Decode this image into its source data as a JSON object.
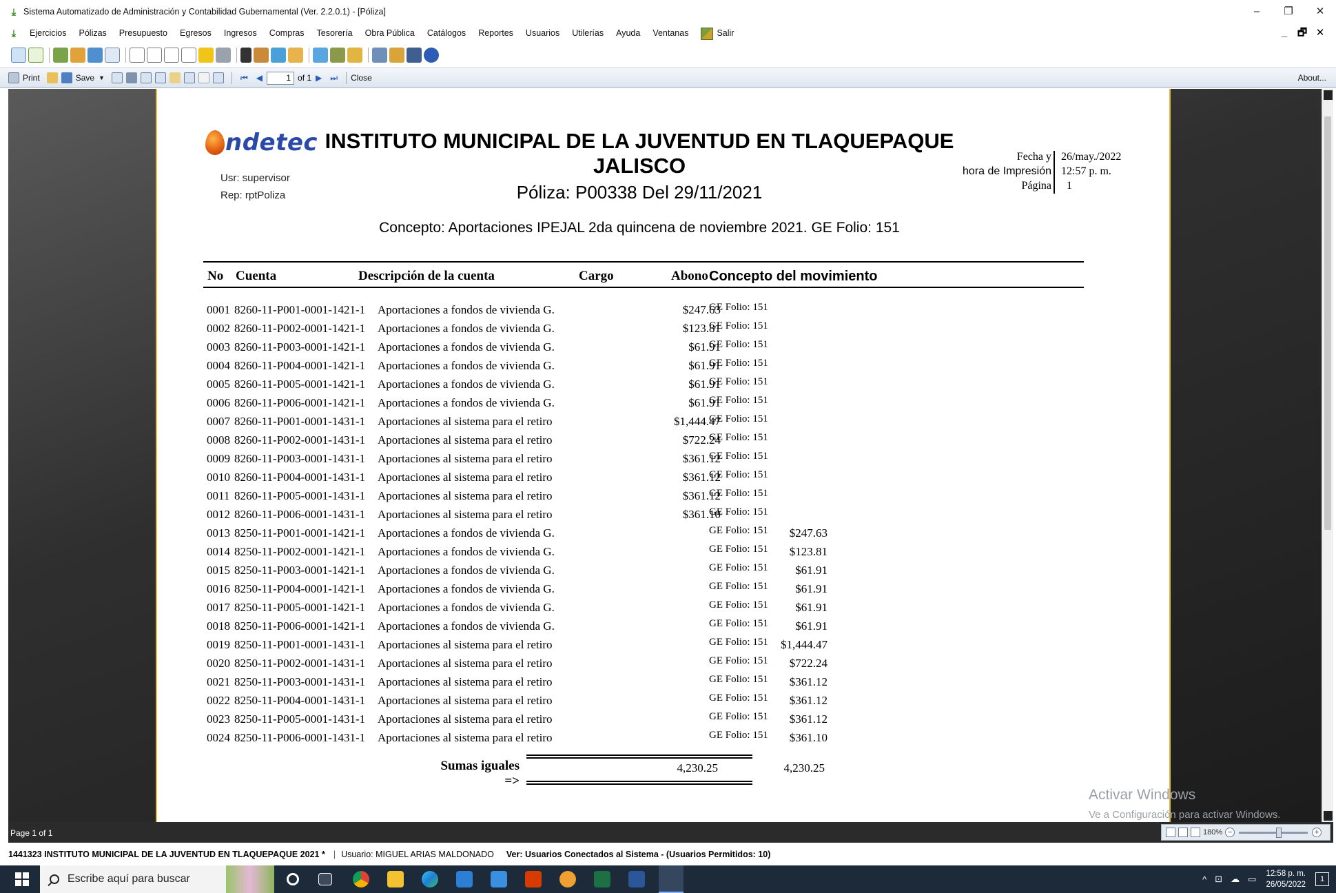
{
  "window": {
    "title": "Sistema Automatizado de Administración y Contabilidad Gubernamental  (Ver. 2.2.0.1) - [Póliza]",
    "controls": [
      "–",
      "❐",
      "✕"
    ]
  },
  "menubar": {
    "items": [
      "Ejercicios",
      "Pólizas",
      "Presupuesto",
      "Egresos",
      "Ingresos",
      "Compras",
      "Tesorería",
      "Obra Pública",
      "Catálogos",
      "Reportes",
      "Usuarios",
      "Utilerías",
      "Ayuda",
      "Ventanas"
    ],
    "salir_label": "Salir",
    "mdi_controls": [
      "_",
      "🗗",
      "✕"
    ]
  },
  "viewer_toolbar": {
    "print_label": "Print",
    "save_label": "Save",
    "page_value": "1",
    "page_of": "of 1",
    "close_label": "Close",
    "about_label": "About..."
  },
  "report": {
    "logo_text": "ndetec",
    "user_line": "Usr: supervisor",
    "rep_line": "Rep: rptPoliza",
    "org_line1": "INSTITUTO MUNICIPAL DE LA JUVENTUD EN TLAQUEPAQUE",
    "org_line2": "JALISCO",
    "poliza_line": "Póliza:  P00338  Del 29/11/2021",
    "concepto_line": "Concepto: Aportaciones IPEJAL 2da quincena de noviembre 2021. GE Folio: 151",
    "fecha_label": "Fecha y",
    "hora_label": "hora de Impresión",
    "pagina_label": "Página",
    "fecha_value": "26/may./2022",
    "hora_value": "12:57 p. m.",
    "pagina_value": "1",
    "headers": {
      "no": "No",
      "cuenta": "Cuenta",
      "descripcion": "Descripción de la cuenta",
      "cargo": "Cargo",
      "abono": "Abono",
      "concepto": "Concepto del movimiento"
    },
    "rows": [
      {
        "no": "0001",
        "cuenta": "8260-11-P001-0001-1421-1",
        "desc": "Aportaciones a fondos de vivienda G.",
        "cargo": "$247.63",
        "abono": "",
        "conc": "GE Folio: 151"
      },
      {
        "no": "0002",
        "cuenta": "8260-11-P002-0001-1421-1",
        "desc": "Aportaciones a fondos de vivienda G.",
        "cargo": "$123.81",
        "abono": "",
        "conc": "GE Folio: 151"
      },
      {
        "no": "0003",
        "cuenta": "8260-11-P003-0001-1421-1",
        "desc": "Aportaciones a fondos de vivienda G.",
        "cargo": "$61.91",
        "abono": "",
        "conc": "GE Folio: 151"
      },
      {
        "no": "0004",
        "cuenta": "8260-11-P004-0001-1421-1",
        "desc": "Aportaciones a fondos de vivienda G.",
        "cargo": "$61.91",
        "abono": "",
        "conc": "GE Folio: 151"
      },
      {
        "no": "0005",
        "cuenta": "8260-11-P005-0001-1421-1",
        "desc": "Aportaciones a fondos de vivienda G.",
        "cargo": "$61.91",
        "abono": "",
        "conc": "GE Folio: 151"
      },
      {
        "no": "0006",
        "cuenta": "8260-11-P006-0001-1421-1",
        "desc": "Aportaciones a fondos de vivienda G.",
        "cargo": "$61.91",
        "abono": "",
        "conc": "GE Folio: 151"
      },
      {
        "no": "0007",
        "cuenta": "8260-11-P001-0001-1431-1",
        "desc": "Aportaciones al sistema para el retiro",
        "cargo": "$1,444.47",
        "abono": "",
        "conc": "GE Folio: 151"
      },
      {
        "no": "0008",
        "cuenta": "8260-11-P002-0001-1431-1",
        "desc": "Aportaciones al sistema para el retiro",
        "cargo": "$722.24",
        "abono": "",
        "conc": "GE Folio: 151"
      },
      {
        "no": "0009",
        "cuenta": "8260-11-P003-0001-1431-1",
        "desc": "Aportaciones al sistema para el retiro",
        "cargo": "$361.12",
        "abono": "",
        "conc": "GE Folio: 151"
      },
      {
        "no": "0010",
        "cuenta": "8260-11-P004-0001-1431-1",
        "desc": "Aportaciones al sistema para el retiro",
        "cargo": "$361.12",
        "abono": "",
        "conc": "GE Folio: 151"
      },
      {
        "no": "0011",
        "cuenta": "8260-11-P005-0001-1431-1",
        "desc": "Aportaciones al sistema para el retiro",
        "cargo": "$361.12",
        "abono": "",
        "conc": "GE Folio: 151"
      },
      {
        "no": "0012",
        "cuenta": "8260-11-P006-0001-1431-1",
        "desc": "Aportaciones al sistema para el retiro",
        "cargo": "$361.10",
        "abono": "",
        "conc": "GE Folio: 151"
      },
      {
        "no": "0013",
        "cuenta": "8250-11-P001-0001-1421-1",
        "desc": "Aportaciones a fondos de vivienda G.",
        "cargo": "",
        "abono": "$247.63",
        "conc": "GE Folio: 151"
      },
      {
        "no": "0014",
        "cuenta": "8250-11-P002-0001-1421-1",
        "desc": "Aportaciones a fondos de vivienda G.",
        "cargo": "",
        "abono": "$123.81",
        "conc": "GE Folio: 151"
      },
      {
        "no": "0015",
        "cuenta": "8250-11-P003-0001-1421-1",
        "desc": "Aportaciones a fondos de vivienda G.",
        "cargo": "",
        "abono": "$61.91",
        "conc": "GE Folio: 151"
      },
      {
        "no": "0016",
        "cuenta": "8250-11-P004-0001-1421-1",
        "desc": "Aportaciones a fondos de vivienda G.",
        "cargo": "",
        "abono": "$61.91",
        "conc": "GE Folio: 151"
      },
      {
        "no": "0017",
        "cuenta": "8250-11-P005-0001-1421-1",
        "desc": "Aportaciones a fondos de vivienda G.",
        "cargo": "",
        "abono": "$61.91",
        "conc": "GE Folio: 151"
      },
      {
        "no": "0018",
        "cuenta": "8250-11-P006-0001-1421-1",
        "desc": "Aportaciones a fondos de vivienda G.",
        "cargo": "",
        "abono": "$61.91",
        "conc": "GE Folio: 151"
      },
      {
        "no": "0019",
        "cuenta": "8250-11-P001-0001-1431-1",
        "desc": "Aportaciones al sistema para el retiro",
        "cargo": "",
        "abono": "$1,444.47",
        "conc": "GE Folio: 151"
      },
      {
        "no": "0020",
        "cuenta": "8250-11-P002-0001-1431-1",
        "desc": "Aportaciones al sistema para el retiro",
        "cargo": "",
        "abono": "$722.24",
        "conc": "GE Folio: 151"
      },
      {
        "no": "0021",
        "cuenta": "8250-11-P003-0001-1431-1",
        "desc": "Aportaciones al sistema para el retiro",
        "cargo": "",
        "abono": "$361.12",
        "conc": "GE Folio: 151"
      },
      {
        "no": "0022",
        "cuenta": "8250-11-P004-0001-1431-1",
        "desc": "Aportaciones al sistema para el retiro",
        "cargo": "",
        "abono": "$361.12",
        "conc": "GE Folio: 151"
      },
      {
        "no": "0023",
        "cuenta": "8250-11-P005-0001-1431-1",
        "desc": "Aportaciones al sistema para el retiro",
        "cargo": "",
        "abono": "$361.12",
        "conc": "GE Folio: 151"
      },
      {
        "no": "0024",
        "cuenta": "8250-11-P006-0001-1431-1",
        "desc": "Aportaciones al sistema para el retiro",
        "cargo": "",
        "abono": "$361.10",
        "conc": "GE Folio: 151"
      }
    ],
    "totals_label": "Sumas iguales =>",
    "total_cargo": "4,230.25",
    "total_abono": "4,230.25"
  },
  "watermark": {
    "line1": "Activar Windows",
    "line2": "Ve a Configuración para activar Windows."
  },
  "viewer_status": {
    "page_info": "Page 1 of 1",
    "zoom": "180%"
  },
  "app_status": {
    "entity": "1441323 INSTITUTO MUNICIPAL DE LA JUVENTUD EN TLAQUEPAQUE  2021   *",
    "user": "Usuario: MIGUEL ARIAS MALDONADO",
    "connected": "Ver: Usuarios Conectados al Sistema - (Usuarios Permitidos: 10)"
  },
  "taskbar": {
    "search_placeholder": "Escribe aquí para buscar",
    "time": "12:58 p. m.",
    "date": "26/05/2022",
    "notifications": "1"
  },
  "colors": {
    "page_border": "#e7b73a",
    "logo_blue": "#2b4aa8",
    "logo_orange": "#e25d10",
    "taskbar": "#1c2a3a"
  }
}
